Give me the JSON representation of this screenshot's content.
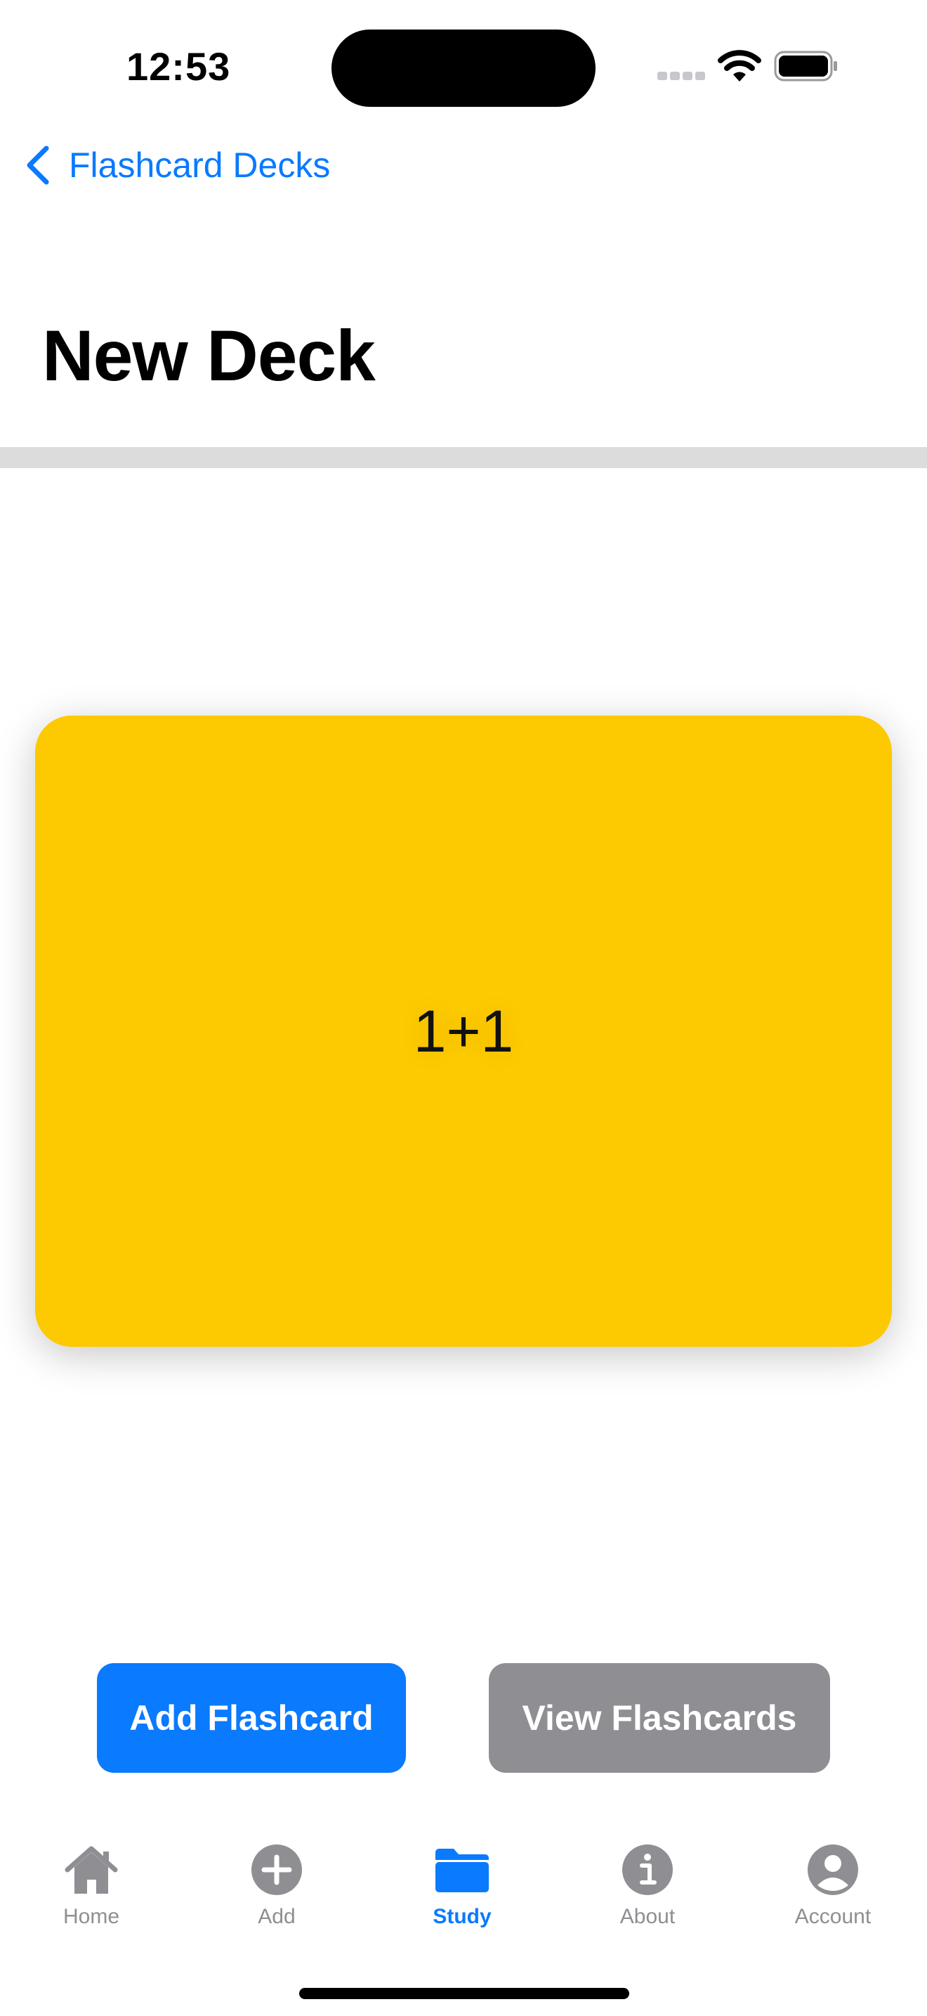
{
  "status_bar": {
    "time": "12:53"
  },
  "nav": {
    "back_label": "Flashcard Decks",
    "back_icon": "chevron-left-icon",
    "title": "New Deck"
  },
  "flashcard": {
    "text": "1+1",
    "color": "#fdc900"
  },
  "actions": {
    "add_label": "Add Flashcard",
    "view_label": "View Flashcards",
    "add_color": "#0a7aff",
    "view_color": "#8e8e93"
  },
  "tab_bar": {
    "active_color": "#0a7aff",
    "inactive_color": "#8e8e93",
    "tabs": [
      {
        "label": "Home",
        "icon": "house-icon"
      },
      {
        "label": "Add",
        "icon": "plus-circle-icon"
      },
      {
        "label": "Study",
        "icon": "folder-icon",
        "active": true
      },
      {
        "label": "About",
        "icon": "info-circle-icon"
      },
      {
        "label": "Account",
        "icon": "person-circle-icon"
      }
    ]
  }
}
